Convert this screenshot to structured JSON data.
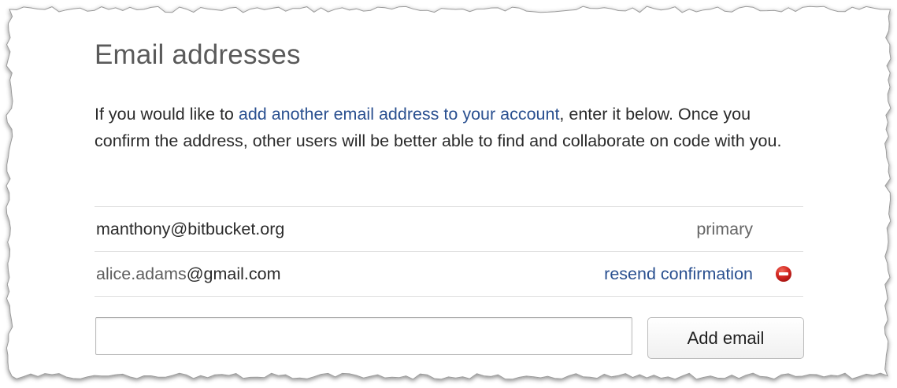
{
  "section": {
    "title": "Email addresses",
    "description_prefix": "If you would like to ",
    "description_link": "add another email address to your account",
    "description_suffix": ", enter it below. Once you confirm the address, other users will be better able to find and collaborate on code with you."
  },
  "emails": [
    {
      "address": "manthony@bitbucket.org",
      "status": "primary"
    },
    {
      "user": "alice.adams",
      "domain": "@gmail.com",
      "action": "resend confirmation",
      "remove_icon": "remove-minus-circle-icon"
    }
  ],
  "form": {
    "input_value": "",
    "button_label": "Add email"
  },
  "colors": {
    "link": "#2a5090",
    "remove_icon": "#c8201c",
    "title": "#5a5a5a"
  }
}
